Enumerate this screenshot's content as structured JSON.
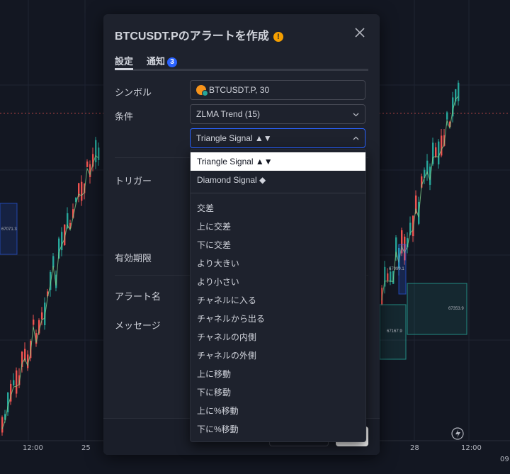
{
  "dialog": {
    "title": "BTCUSDT.Pのアラートを作成",
    "warning_icon": "!",
    "tabs": [
      {
        "label": "設定",
        "active": true
      },
      {
        "label": "通知",
        "badge": "3"
      }
    ],
    "labels": {
      "symbol": "シンボル",
      "condition": "条件",
      "trigger": "トリガー",
      "expiration": "有効期限",
      "alert_name": "アラート名",
      "message": "メッセージ"
    },
    "symbol_value": "BTCUSDT.P, 30",
    "condition_value": "ZLMA Trend (15)",
    "signal_value": "Triangle Signal ▲▼"
  },
  "dropdown": {
    "options_top": [
      "Triangle Signal ▲▼",
      "Diamond Signal ◆"
    ],
    "options": [
      "交差",
      "上に交差",
      "下に交差",
      "より大きい",
      "より小さい",
      "チャネルに入る",
      "チャネルから出る",
      "チャネルの内側",
      "チャネルの外側",
      "上に移動",
      "下に移動",
      "上に%移動",
      "下に%移動"
    ]
  },
  "chart": {
    "x_labels": [
      "12:00",
      "25",
      "28",
      "12:00",
      "09"
    ],
    "box_labels": [
      "67071.3",
      "67099.1",
      "67353.9",
      "67167.9"
    ],
    "colors": {
      "bull": "#26a69a",
      "bear": "#ef5350",
      "band": "#1b5e20",
      "accent": "#2962ff"
    }
  },
  "icons": {
    "close": "close-icon",
    "lightning": "lightning-icon",
    "chevron_down": "chevron-down-icon",
    "chevron_up": "chevron-up-icon"
  }
}
